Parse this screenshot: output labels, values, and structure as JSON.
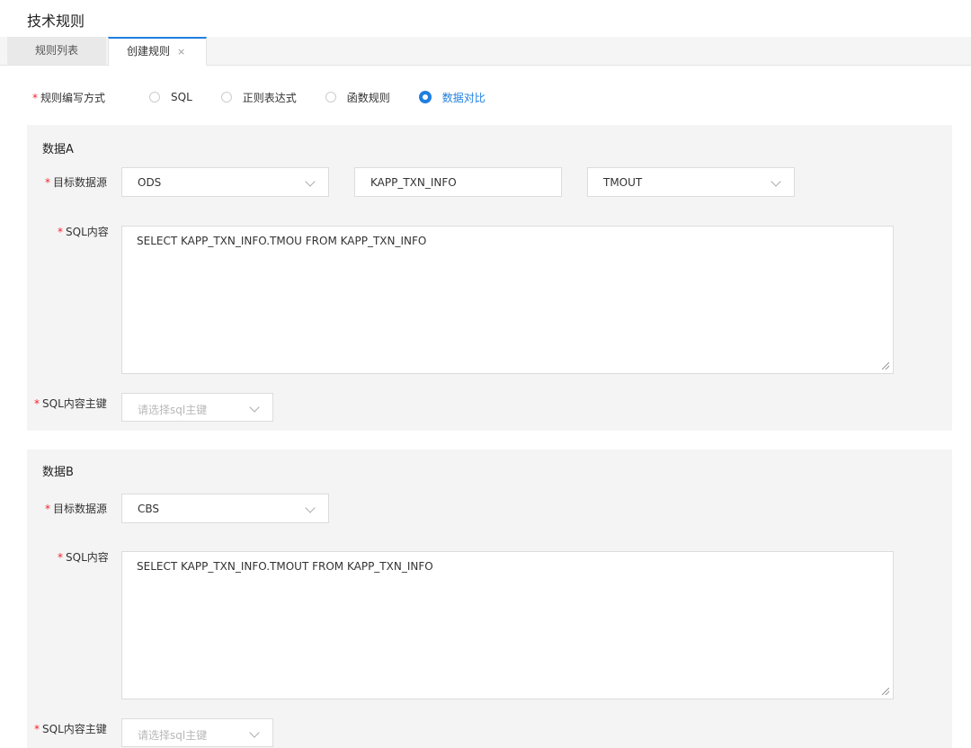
{
  "page": {
    "title": "技术规则"
  },
  "tabs": [
    {
      "label": "规则列表"
    },
    {
      "label": "创建规则",
      "close": "×"
    }
  ],
  "form": {
    "mode_label": "规则编写方式",
    "required_mark": "*",
    "modes": [
      "SQL",
      "正则表达式",
      "函数规则",
      "数据对比"
    ],
    "selected_mode": "数据对比"
  },
  "data_a": {
    "title": "数据A",
    "source_label": "目标数据源",
    "source_value": "ODS",
    "table_value": "KAPP_TXN_INFO",
    "column_value": "TMOUT",
    "sql_label": "SQL内容",
    "sql_value": "SELECT KAPP_TXN_INFO.TMOU FROM KAPP_TXN_INFO",
    "key_label": "SQL内容主键",
    "key_placeholder": "请选择sql主键"
  },
  "data_b": {
    "title": "数据B",
    "source_label": "目标数据源",
    "source_value": "CBS",
    "sql_label": "SQL内容",
    "sql_value": "SELECT KAPP_TXN_INFO.TMOUT FROM KAPP_TXN_INFO",
    "key_label": "SQL内容主键",
    "key_placeholder": "请选择sql主键"
  },
  "icons": {
    "dropdown": "chevron-down-icon",
    "close": "close-icon"
  },
  "colors": {
    "accent": "#1e7fe0",
    "required": "#f5222d",
    "panel_bg": "#f4f4f4"
  }
}
